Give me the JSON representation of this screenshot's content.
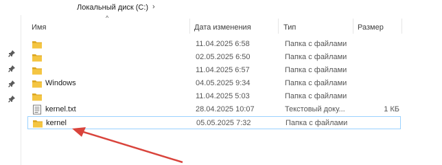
{
  "breadcrumb": {
    "label": "Локальный диск (C:)",
    "separator": "›",
    "arrow": "›"
  },
  "columns": {
    "name": "Имя",
    "date": "Дата изменения",
    "type": "Тип",
    "size": "Размер"
  },
  "rows": [
    {
      "name": "",
      "date": "11.04.2025 6:58",
      "type": "Папка с файлами",
      "size": "",
      "icon": "folder-icon"
    },
    {
      "name": "",
      "date": "02.05.2025 6:50",
      "type": "Папка с файлами",
      "size": "",
      "icon": "folder-icon"
    },
    {
      "name": "",
      "date": "11.04.2025 6:57",
      "type": "Папка с файлами",
      "size": "",
      "icon": "folder-icon"
    },
    {
      "name": "Windows",
      "date": "04.05.2025 9:34",
      "type": "Папка с файлами",
      "size": "",
      "icon": "folder-icon"
    },
    {
      "name": "",
      "date": "11.04.2025 5:03",
      "type": "Папка с файлами",
      "size": "",
      "icon": "folder-icon"
    },
    {
      "name": "kernel.txt",
      "date": "28.04.2025 10:07",
      "type": "Текстовый доку...",
      "size": "1 КБ",
      "icon": "text-file-icon"
    },
    {
      "name": "kernel",
      "date": "05.05.2025 7:32",
      "type": "Папка с файлами",
      "size": "",
      "icon": "folder-icon"
    }
  ],
  "sidebar": {
    "pins": [
      "pin-icon",
      "pin-icon",
      "pin-icon",
      "pin-icon"
    ]
  },
  "colors": {
    "folder": "#f4c542",
    "folder_dark": "#dba520",
    "selection_border": "#99d1ff",
    "annotation_arrow": "#d9443c"
  }
}
